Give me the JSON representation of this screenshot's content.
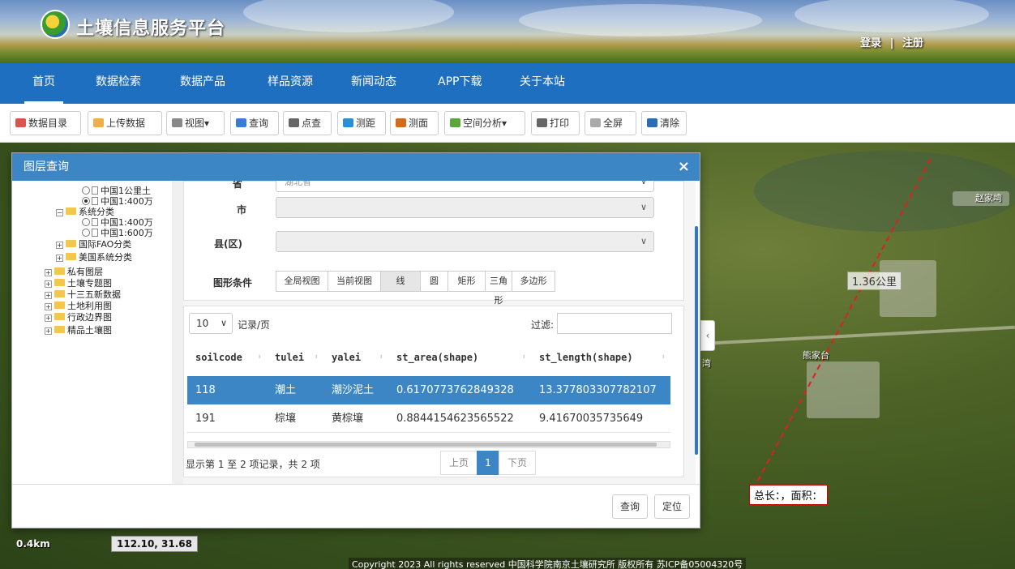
{
  "header": {
    "site_title": "土壤信息服务平台",
    "login": "登录",
    "separator": "|",
    "register": "注册"
  },
  "nav": {
    "items": [
      "首页",
      "数据检索",
      "数据产品",
      "样品资源",
      "新闻动态",
      "APP下载",
      "关于本站"
    ],
    "active_index": 0
  },
  "toolbar": {
    "buttons": [
      {
        "label": "数据目录",
        "icon": "layers-icon"
      },
      {
        "label": "上传数据",
        "icon": "upload-icon"
      },
      {
        "label": "视图",
        "icon": "magnifier-icon",
        "dropdown": "▾"
      },
      {
        "label": "查询",
        "icon": "query-icon"
      },
      {
        "label": "点查",
        "icon": "point-query-icon"
      },
      {
        "label": "测距",
        "icon": "ruler-icon"
      },
      {
        "label": "测面",
        "icon": "area-icon"
      },
      {
        "label": "空间分析",
        "icon": "spatial-icon",
        "dropdown": "▾"
      },
      {
        "label": "打印",
        "icon": "print-icon"
      },
      {
        "label": "全屏",
        "icon": "fullscreen-icon"
      },
      {
        "label": "清除",
        "icon": "clear-icon"
      }
    ]
  },
  "dialog": {
    "title": "图层查询",
    "close": "×",
    "tree": [
      {
        "text": "中国1公里土",
        "kind": "leaf",
        "radio": false
      },
      {
        "text": "中国1:400万",
        "kind": "leaf",
        "radio": true
      },
      {
        "text": "系统分类",
        "kind": "folder",
        "toggle": "−"
      },
      {
        "text": "中国1:400万",
        "kind": "leaf",
        "radio": false
      },
      {
        "text": "中国1:600万",
        "kind": "leaf",
        "radio": false
      },
      {
        "text": "国际FAO分类",
        "kind": "folder",
        "toggle": "+"
      },
      {
        "text": "美国系统分类",
        "kind": "folder",
        "toggle": "+"
      },
      {
        "text": "私有图层",
        "kind": "folder",
        "toggle": "+"
      },
      {
        "text": "土壤专题图",
        "kind": "folder",
        "toggle": "+"
      },
      {
        "text": "十三五新数据",
        "kind": "folder",
        "toggle": "+"
      },
      {
        "text": "土地利用图",
        "kind": "folder",
        "toggle": "+"
      },
      {
        "text": "行政边界图",
        "kind": "folder",
        "toggle": "+"
      },
      {
        "text": "精品土壤图",
        "kind": "folder",
        "toggle": "+"
      }
    ],
    "form": {
      "province_label": "省",
      "province_value": "湖北省",
      "city_label": "市",
      "county_label": "县(区)",
      "shape_label": "图形条件",
      "shape_buttons": [
        "全局视图",
        "当前视图",
        "线",
        "圆",
        "矩形",
        "三角形",
        "多边形"
      ],
      "shape_active": 2,
      "chevron": "∨"
    },
    "table": {
      "page_size": "10",
      "page_size_suffix": "记录/页",
      "filter_label": "过滤:",
      "filter_value": "",
      "columns": [
        "soilcode",
        "tulei",
        "yalei",
        "st_area(shape)",
        "st_length(shape)"
      ],
      "sort_icon": "⬍",
      "rows": [
        [
          "118",
          "潮土",
          "潮沙泥土",
          "0.6170773762849328",
          "13.377803307782107"
        ],
        [
          "191",
          "棕壤",
          "黄棕壤",
          "0.8844154623565522",
          "9.41670035735649"
        ]
      ],
      "selected_row": 0,
      "info": "显示第 1 至 2 项记录，共 2 项",
      "prev": "上页",
      "current_page": "1",
      "next": "下页"
    },
    "footer": {
      "query": "查询",
      "locate": "定位"
    }
  },
  "map": {
    "measure_label": "1.36公里",
    "measure_result": "总长：，面积：",
    "scale": "0.4km",
    "coords": "112.10, 31.68",
    "copyright": "Copyright 2023 All rights reserved 中国科学院南京土壤研究所 版权所有 苏ICP备05004320号",
    "place_labels": [
      "赵家塆",
      "熊家台",
      "湾"
    ],
    "collapse": "‹"
  }
}
